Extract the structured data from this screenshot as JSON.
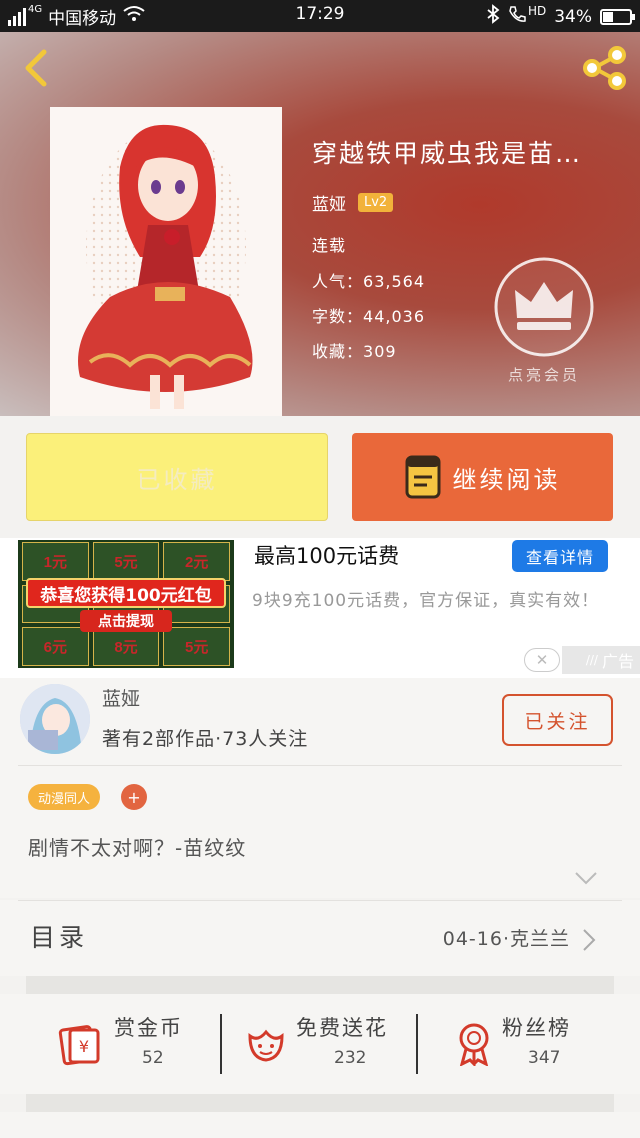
{
  "status_bar": {
    "network": "4G",
    "carrier": "中国移动",
    "time": "17:29",
    "hd": "HD",
    "battery": "34%",
    "battery_level": 0.34
  },
  "book": {
    "title": "穿越铁甲威虫我是苗…",
    "author": "蓝娅",
    "level": "Lv2",
    "status": "连载",
    "popularity_label": "人气：",
    "popularity": "63,564",
    "word_count_label": "字数：",
    "word_count": "44,036",
    "favorites_label": "收藏：",
    "favorites": "309",
    "vip_label": "点亮会员"
  },
  "actions": {
    "collected_label": "已收藏",
    "continue_label": "继续阅读"
  },
  "ad": {
    "cells": [
      "1元",
      "5元",
      "2元",
      "",
      "",
      "",
      "6元",
      "8元",
      "5元"
    ],
    "banner": "恭喜您获得100元红包",
    "banner_button": "点击提现",
    "title": "最高100元话费",
    "detail_button": "查看详情",
    "description": "9块9充100元话费，官方保证，真实有效！",
    "tag": "广告",
    "close_icon": "close-icon"
  },
  "author_card": {
    "name": "蓝娅",
    "stats": "著有2部作品·73人关注",
    "follow_label": "已关注",
    "tag": "动漫同人",
    "tag_add": "+",
    "intro": "剧情不太对啊？-苗纹纹"
  },
  "catalog": {
    "label": "目录",
    "latest": "04-16·克兰兰"
  },
  "stats": [
    {
      "icon": "coin-envelope-icon",
      "label": "赏金币",
      "value": "52"
    },
    {
      "icon": "flower-icon",
      "label": "免费送花",
      "value": "232"
    },
    {
      "icon": "ribbon-icon",
      "label": "粉丝榜",
      "value": "347"
    }
  ],
  "colors": {
    "accent_orange": "#e9683a",
    "collected_yellow": "#fbf07a",
    "ad_blue": "#1e7ae6",
    "tag_orange": "#f5b23e"
  }
}
